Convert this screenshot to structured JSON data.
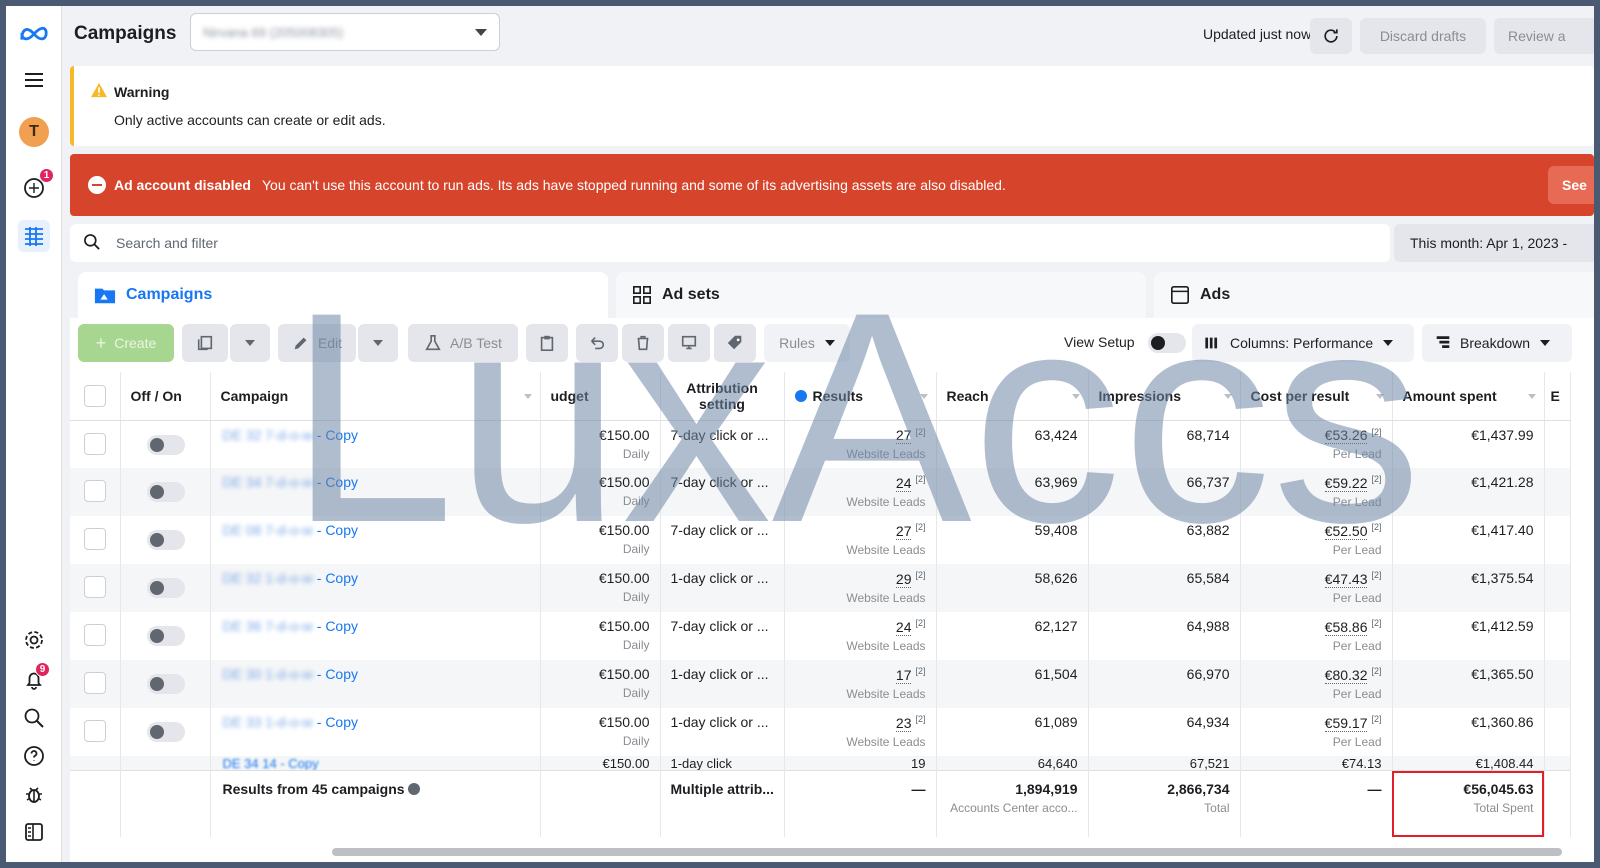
{
  "header": {
    "title": "Campaigns",
    "account_name": "Nirvana 69 (205008305)",
    "updated": "Updated just now",
    "discard_label": "Discard drafts",
    "review_label": "Review a"
  },
  "rail": {
    "notifications_badge": "1",
    "alerts_badge": "9"
  },
  "warning": {
    "title": "Warning",
    "message": "Only active accounts can create or edit ads."
  },
  "error": {
    "title": "Ad account disabled",
    "message": "You can't use this account to run ads. Its ads have stopped running and some of its advertising assets are also disabled.",
    "action": "See"
  },
  "search": {
    "placeholder": "Search and filter"
  },
  "date_range": "This month: Apr 1, 2023 -",
  "tabs": [
    {
      "label": "Campaigns"
    },
    {
      "label": "Ad sets"
    },
    {
      "label": "Ads"
    }
  ],
  "toolbar": {
    "create": "Create",
    "edit": "Edit",
    "ab_test": "A/B Test",
    "rules": "Rules",
    "view_setup": "View Setup",
    "columns": "Columns: Performance",
    "breakdown": "Breakdown"
  },
  "columns": {
    "off_on": "Off / On",
    "campaign": "Campaign",
    "budget": "udget",
    "attribution": "Attribution setting",
    "results": "Results",
    "reach": "Reach",
    "impressions": "Impressions",
    "cost": "Cost per result",
    "spent": "Amount spent",
    "extra": "E"
  },
  "rows": [
    {
      "name_prefix": "DE 32 7-d-o-w",
      "name_suffix": "- Copy",
      "budget": "€150.00",
      "budget_type": "Daily",
      "attribution": "7-day click or ...",
      "results": "27",
      "results_type": "Website Leads",
      "reach": "63,424",
      "impressions": "68,714",
      "cost": "€53.26",
      "cost_type": "Per Lead",
      "spent": "€1,437.99",
      "note": "[2]"
    },
    {
      "name_prefix": "DE 34 7-d-o-w",
      "name_suffix": "- Copy",
      "budget": "€150.00",
      "budget_type": "Daily",
      "attribution": "7-day click or ...",
      "results": "24",
      "results_type": "Website Leads",
      "reach": "63,969",
      "impressions": "66,737",
      "cost": "€59.22",
      "cost_type": "Per Lead",
      "spent": "€1,421.28",
      "note": "[2]"
    },
    {
      "name_prefix": "DE 08 7-d-o-w",
      "name_suffix": "- Copy",
      "budget": "€150.00",
      "budget_type": "Daily",
      "attribution": "7-day click or ...",
      "results": "27",
      "results_type": "Website Leads",
      "reach": "59,408",
      "impressions": "63,882",
      "cost": "€52.50",
      "cost_type": "Per Lead",
      "spent": "€1,417.40",
      "note": "[2]"
    },
    {
      "name_prefix": "DE 32 1-d-o-w",
      "name_suffix": "- Copy",
      "budget": "€150.00",
      "budget_type": "Daily",
      "attribution": "1-day click or ...",
      "results": "29",
      "results_type": "Website Leads",
      "reach": "58,626",
      "impressions": "65,584",
      "cost": "€47.43",
      "cost_type": "Per Lead",
      "spent": "€1,375.54",
      "note": "[2]"
    },
    {
      "name_prefix": "DE 36 7-d-o-w",
      "name_suffix": "- Copy",
      "budget": "€150.00",
      "budget_type": "Daily",
      "attribution": "7-day click or ...",
      "results": "24",
      "results_type": "Website Leads",
      "reach": "62,127",
      "impressions": "64,988",
      "cost": "€58.86",
      "cost_type": "Per Lead",
      "spent": "€1,412.59",
      "note": "[2]"
    },
    {
      "name_prefix": "DE 30 1-d-o-w",
      "name_suffix": "- Copy",
      "budget": "€150.00",
      "budget_type": "Daily",
      "attribution": "1-day click or ...",
      "results": "17",
      "results_type": "Website Leads",
      "reach": "61,504",
      "impressions": "66,970",
      "cost": "€80.32",
      "cost_type": "Per Lead",
      "spent": "€1,365.50",
      "note": "[2]"
    },
    {
      "name_prefix": "DE 33 1-d-o-w",
      "name_suffix": "- Copy",
      "budget": "€150.00",
      "budget_type": "Daily",
      "attribution": "1-day click or ...",
      "results": "23",
      "results_type": "Website Leads",
      "reach": "61,089",
      "impressions": "64,934",
      "cost": "€59.17",
      "cost_type": "Per Lead",
      "spent": "€1,360.86",
      "note": "[2]"
    }
  ],
  "partial_row": {
    "name": "DE 34 14 - Copy",
    "budget": "€150.00",
    "attribution": "1-day click",
    "results": "19",
    "reach": "64,640",
    "impressions": "67,521",
    "cost": "€74.13",
    "spent": "€1,408.44"
  },
  "summary": {
    "label": "Results from 45 campaigns",
    "attribution": "Multiple attrib...",
    "results": "—",
    "reach": "1,894,919",
    "reach_note": "Accounts Center acco...",
    "impressions": "2,866,734",
    "impressions_note": "Total",
    "cost": "—",
    "spent": "€56,045.63",
    "spent_note": "Total Spent"
  },
  "watermark": "LuxAccs",
  "colors": {
    "accent": "#1877f2",
    "error": "#d6452b",
    "warning": "#f7b928",
    "create": "#a6d68f",
    "highlight": "#e41e26"
  }
}
